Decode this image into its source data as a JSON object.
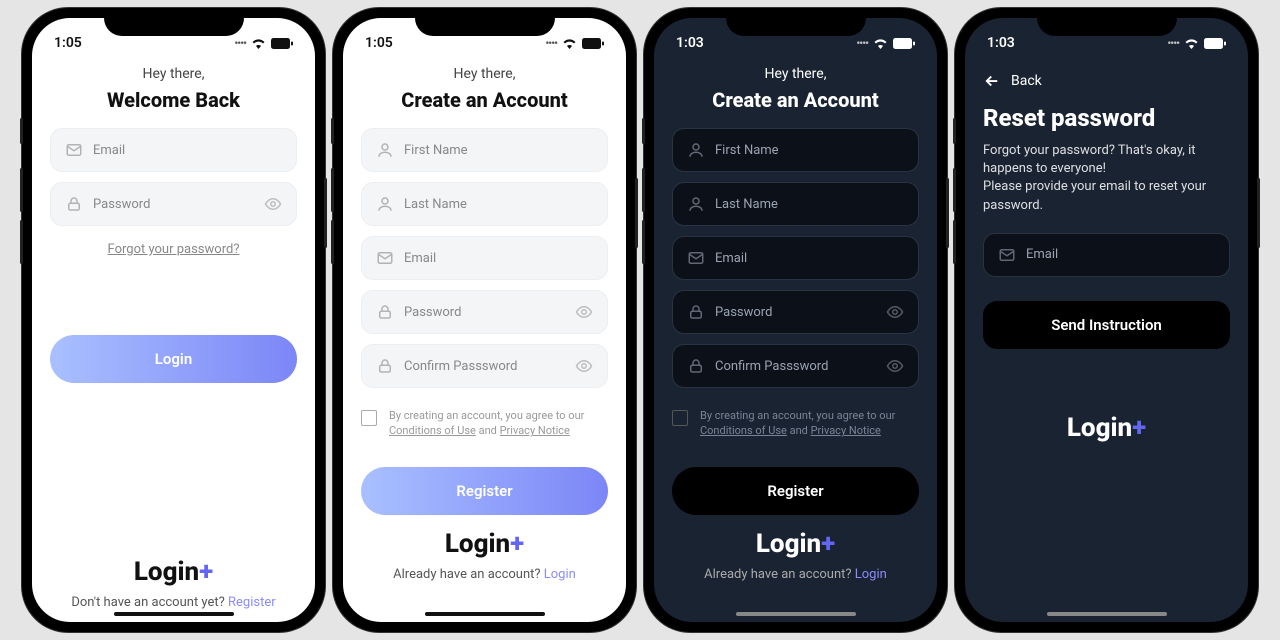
{
  "statusbar": {
    "time_light": "1:05",
    "time_dark": "1:03"
  },
  "common": {
    "greet": "Hey there,",
    "logo": "Login",
    "email_ph": "Email",
    "password_ph": "Password",
    "firstname_ph": "First Name",
    "lastname_ph": "Last Name",
    "confirm_ph": "Confirm Passsword",
    "terms_pre": "By creating an account, you agree to our ",
    "terms_cond": "Conditions of Use",
    "terms_and": " and ",
    "terms_priv": "Privacy Notice"
  },
  "s1": {
    "title": "Welcome Back",
    "forgot": "Forgot your password?",
    "login_btn": "Login",
    "noacct": "Don't have an account yet? ",
    "register": "Register"
  },
  "s2": {
    "title": "Create an Account",
    "register_btn": "Register",
    "already": "Already have an account? ",
    "login": "Login"
  },
  "s3": {
    "title": "Create an Account",
    "register_btn": "Register",
    "already": "Already have an account? ",
    "login": "Login"
  },
  "s4": {
    "back": "Back",
    "title": "Reset password",
    "desc1": "Forgot your password? That's okay, it happens to everyone!",
    "desc2": "Please provide your email to reset your password.",
    "btn": "Send Instruction"
  }
}
